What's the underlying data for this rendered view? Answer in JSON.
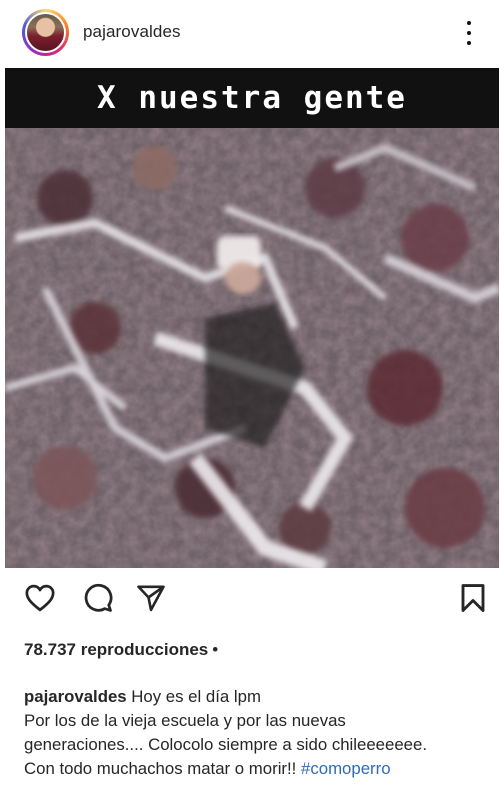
{
  "post": {
    "username": "pajarovaldes",
    "media": {
      "banner_text": "X  nuestra gente"
    },
    "icons": {
      "like": "heart-icon",
      "comment": "comment-icon",
      "share": "paper-plane-icon",
      "save": "bookmark-icon",
      "more": "more-vertical-icon"
    },
    "views": {
      "text": "78.737 reproducciones",
      "separator": "•"
    },
    "caption": {
      "username": "pajarovaldes",
      "line1": "Hoy es el día  lpm",
      "line2": "Por los de la vieja escuela y por las nuevas",
      "line3": "generaciones.... Colocolo siempre a sido chileeeeeee.",
      "line4": "Con todo muchachos matar o morir!!",
      "hashtag": "#comoperro"
    }
  }
}
